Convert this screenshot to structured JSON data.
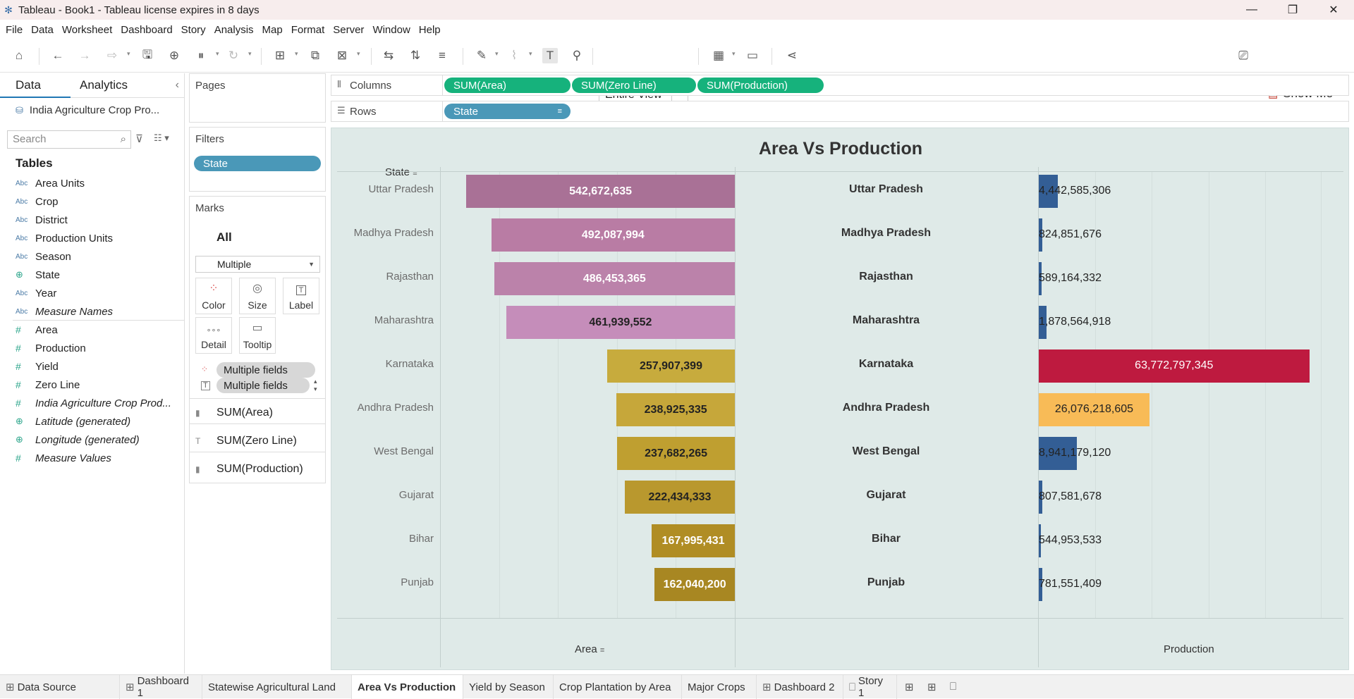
{
  "window": {
    "title": "Tableau - Book1 - Tableau license expires in 8 days",
    "minimize": "—",
    "restore": "❐",
    "close": "✕"
  },
  "menu": [
    "File",
    "Data",
    "Worksheet",
    "Dashboard",
    "Story",
    "Analysis",
    "Map",
    "Format",
    "Server",
    "Window",
    "Help"
  ],
  "toolbar": {
    "fit_select": "Entire View",
    "show_me": "Show Me"
  },
  "data_pane": {
    "tab_data": "Data",
    "tab_analytics": "Analytics",
    "collapse": "‹",
    "datasource": "India Agriculture Crop Pro...",
    "search_placeholder": "Search",
    "tables_heading": "Tables",
    "dimensions": [
      {
        "type": "Abc",
        "name": "Area Units",
        "italic": false
      },
      {
        "type": "Abc",
        "name": "Crop",
        "italic": false
      },
      {
        "type": "Abc",
        "name": "District",
        "italic": false
      },
      {
        "type": "Abc",
        "name": "Production Units",
        "italic": false
      },
      {
        "type": "Abc",
        "name": "Season",
        "italic": false
      },
      {
        "type": "geo",
        "name": "State",
        "italic": false
      },
      {
        "type": "Abc",
        "name": "Year",
        "italic": false
      },
      {
        "type": "Abc",
        "name": "Measure Names",
        "italic": true
      }
    ],
    "measures": [
      {
        "type": "#",
        "name": "Area",
        "italic": false
      },
      {
        "type": "#",
        "name": "Production",
        "italic": false
      },
      {
        "type": "#",
        "name": "Yield",
        "italic": false
      },
      {
        "type": "#",
        "name": "Zero Line",
        "italic": false
      },
      {
        "type": "#",
        "name": "India Agriculture Crop Prod...",
        "italic": true
      },
      {
        "type": "geo",
        "name": "Latitude (generated)",
        "italic": true
      },
      {
        "type": "geo",
        "name": "Longitude (generated)",
        "italic": true
      },
      {
        "type": "#",
        "name": "Measure Values",
        "italic": true
      }
    ]
  },
  "pages": {
    "title": "Pages"
  },
  "filters": {
    "title": "Filters",
    "pills": [
      "State"
    ]
  },
  "marks": {
    "title": "Marks",
    "all": "All",
    "mark_type": "Multiple",
    "buttons": [
      "Color",
      "Size",
      "Label",
      "Detail",
      "Tooltip"
    ],
    "fields": [
      "Multiple fields",
      "Multiple fields"
    ],
    "cards": [
      "SUM(Area)",
      "SUM(Zero Line)",
      "SUM(Production)"
    ]
  },
  "shelves": {
    "columns_label": "Columns",
    "columns": [
      "SUM(Area)",
      "SUM(Zero Line)",
      "SUM(Production)"
    ],
    "rows_label": "Rows",
    "rows": [
      "State"
    ]
  },
  "chart_data": {
    "type": "bar",
    "title": "Area Vs Production",
    "row_header": "State",
    "categories": [
      "Uttar Pradesh",
      "Madhya Pradesh",
      "Rajasthan",
      "Maharashtra",
      "Karnataka",
      "Andhra Pradesh",
      "West Bengal",
      "Gujarat",
      "Bihar",
      "Punjab"
    ],
    "series": [
      {
        "name": "Area",
        "values": [
          542672635,
          492087994,
          486453365,
          461939552,
          257907399,
          238925335,
          237682265,
          222434333,
          167995431,
          162040200
        ],
        "labels": [
          "542,672,635",
          "492,087,994",
          "486,453,365",
          "461,939,552",
          "257,907,399",
          "238,925,335",
          "237,682,265",
          "222,434,333",
          "167,995,431",
          "162,040,200"
        ],
        "colors": [
          "#a97196",
          "#b97ca4",
          "#bb82aa",
          "#c58dba",
          "#c7ab3d",
          "#c6a73a",
          "#bf9f30",
          "#b9982e",
          "#b08d24",
          "#a88722"
        ],
        "label_colors": [
          "#ffffff",
          "#ffffff",
          "#ffffff",
          "#222222",
          "#222222",
          "#222222",
          "#222222",
          "#222222",
          "#ffffff",
          "#ffffff"
        ],
        "direction": "reversed",
        "xlim": [
          0,
          570000000
        ]
      },
      {
        "name": "Production",
        "values": [
          4442585306,
          824851676,
          589164332,
          1878564918,
          63772797345,
          26076218605,
          8941179120,
          807581678,
          544953533,
          781551409
        ],
        "labels": [
          "4,442,585,306",
          "824,851,676",
          "589,164,332",
          "1,878,564,918",
          "63,772,797,345",
          "26,076,218,605",
          "8,941,179,120",
          "807,581,678",
          "544,953,533",
          "781,551,409"
        ],
        "colors": [
          "#335e95",
          "#335e95",
          "#335e95",
          "#335e95",
          "#be1a3f",
          "#f8bb57",
          "#335e95",
          "#335e95",
          "#335e95",
          "#335e95"
        ],
        "label_colors": [
          "#222222",
          "#222222",
          "#222222",
          "#222222",
          "#ffffff",
          "#222222",
          "#222222",
          "#222222",
          "#222222",
          "#222222"
        ],
        "xlim": [
          0,
          67000000000
        ]
      }
    ],
    "middle_column": "Zero Line (state labels)",
    "xlabel_left": "Area",
    "xlabel_right": "Production",
    "grid": true
  },
  "sheet_tabs": [
    {
      "label": "Data Source",
      "icon": "⊞",
      "active": false
    },
    {
      "label": "Dashboard 1",
      "icon": "⊞",
      "active": false
    },
    {
      "label": "Statewise Agricultural Land",
      "icon": "",
      "active": false
    },
    {
      "label": "Area Vs Production",
      "icon": "",
      "active": true
    },
    {
      "label": "Yield by Season",
      "icon": "",
      "active": false
    },
    {
      "label": "Crop Plantation by Area",
      "icon": "",
      "active": false
    },
    {
      "label": "Major Crops",
      "icon": "",
      "active": false
    },
    {
      "label": "Dashboard 2",
      "icon": "⊞",
      "active": false
    },
    {
      "label": "Story 1",
      "icon": "⎕",
      "active": false
    }
  ]
}
